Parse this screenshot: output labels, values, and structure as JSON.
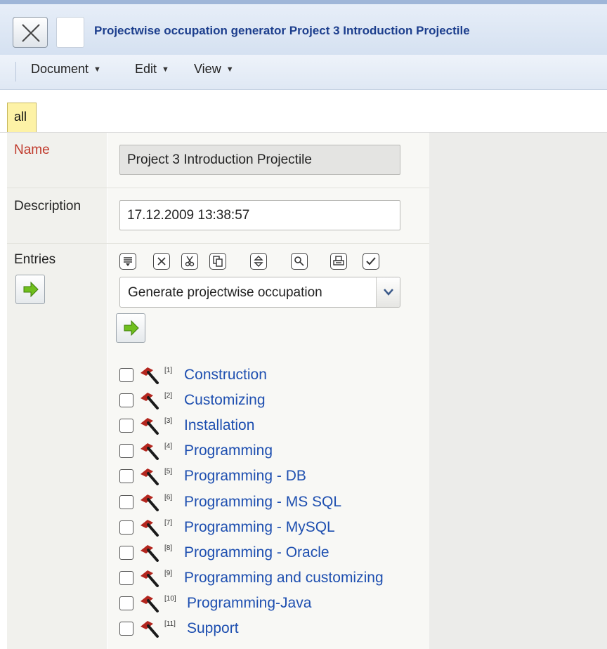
{
  "window": {
    "title": "Projectwise occupation generator Project 3 Introduction Projectile"
  },
  "menu": {
    "document": "Document",
    "edit": "Edit",
    "view": "View"
  },
  "tabs": {
    "all": "all"
  },
  "form": {
    "name_label": "Name",
    "name_value": "Project 3 Introduction Projectile",
    "description_label": "Description",
    "description_value": "17.12.2009 13:38:57",
    "entries_label": "Entries",
    "action_select": "Generate projectwise occupation"
  },
  "entries": [
    {
      "num": "[1]",
      "label": "Construction"
    },
    {
      "num": "[2]",
      "label": "Customizing"
    },
    {
      "num": "[3]",
      "label": "Installation"
    },
    {
      "num": "[4]",
      "label": "Programming"
    },
    {
      "num": "[5]",
      "label": "Programming - DB"
    },
    {
      "num": "[6]",
      "label": "Programming - MS SQL"
    },
    {
      "num": "[7]",
      "label": "Programming - MySQL"
    },
    {
      "num": "[8]",
      "label": "Programming - Oracle"
    },
    {
      "num": "[9]",
      "label": "Programming and customizing"
    },
    {
      "num": "[10]",
      "label": "Programming-Java"
    },
    {
      "num": "[11]",
      "label": "Support"
    }
  ],
  "colors": {
    "title_text": "#1c3e8d",
    "link": "#1e4fb0",
    "required_label": "#c0392b",
    "tab_bg": "#fdf2a6",
    "go_arrow": "#6fbf1e"
  }
}
